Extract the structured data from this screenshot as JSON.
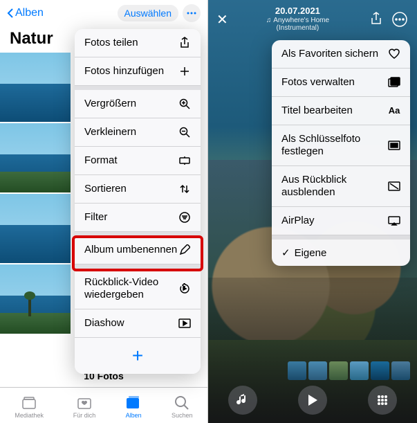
{
  "left": {
    "back_label": "Alben",
    "select_label": "Auswählen",
    "title": "Natur",
    "menu": [
      {
        "label": "Fotos teilen",
        "icon": "share-icon"
      },
      {
        "label": "Fotos hinzufügen",
        "icon": "plus-icon"
      },
      {
        "label": "Vergrößern",
        "icon": "zoom-in-icon"
      },
      {
        "label": "Verkleinern",
        "icon": "zoom-out-icon"
      },
      {
        "label": "Format",
        "icon": "aspect-icon"
      },
      {
        "label": "Sortieren",
        "icon": "sort-icon"
      },
      {
        "label": "Filter",
        "icon": "filter-icon"
      },
      {
        "label": "Album umbenennen",
        "icon": "pencil-icon"
      },
      {
        "label": "Rückblick-Video wiedergeben",
        "icon": "replay-icon"
      },
      {
        "label": "Diashow",
        "icon": "play-rect-icon"
      }
    ],
    "footer_count": "10 Fotos",
    "tabs": [
      {
        "label": "Mediathek",
        "icon": "library-icon"
      },
      {
        "label": "Für dich",
        "icon": "foryou-icon"
      },
      {
        "label": "Alben",
        "icon": "albums-icon",
        "active": true
      },
      {
        "label": "Suchen",
        "icon": "search-icon"
      }
    ]
  },
  "right": {
    "date": "20.07.2021",
    "track": "Anywhere's Home",
    "track_sub": "(Instrumental)",
    "menu": [
      {
        "label": "Als Favoriten sichern",
        "icon": "heart-icon"
      },
      {
        "label": "Fotos verwalten",
        "icon": "photos-manage-icon"
      },
      {
        "label": "Titel bearbeiten",
        "icon": "aa-icon"
      },
      {
        "label": "Als Schlüsselfoto festlegen",
        "icon": "keyphoto-icon"
      },
      {
        "label": "Aus Rückblick ausblenden",
        "icon": "hide-icon"
      },
      {
        "label": "AirPlay",
        "icon": "airplay-icon"
      }
    ],
    "selected": "Eigene"
  }
}
